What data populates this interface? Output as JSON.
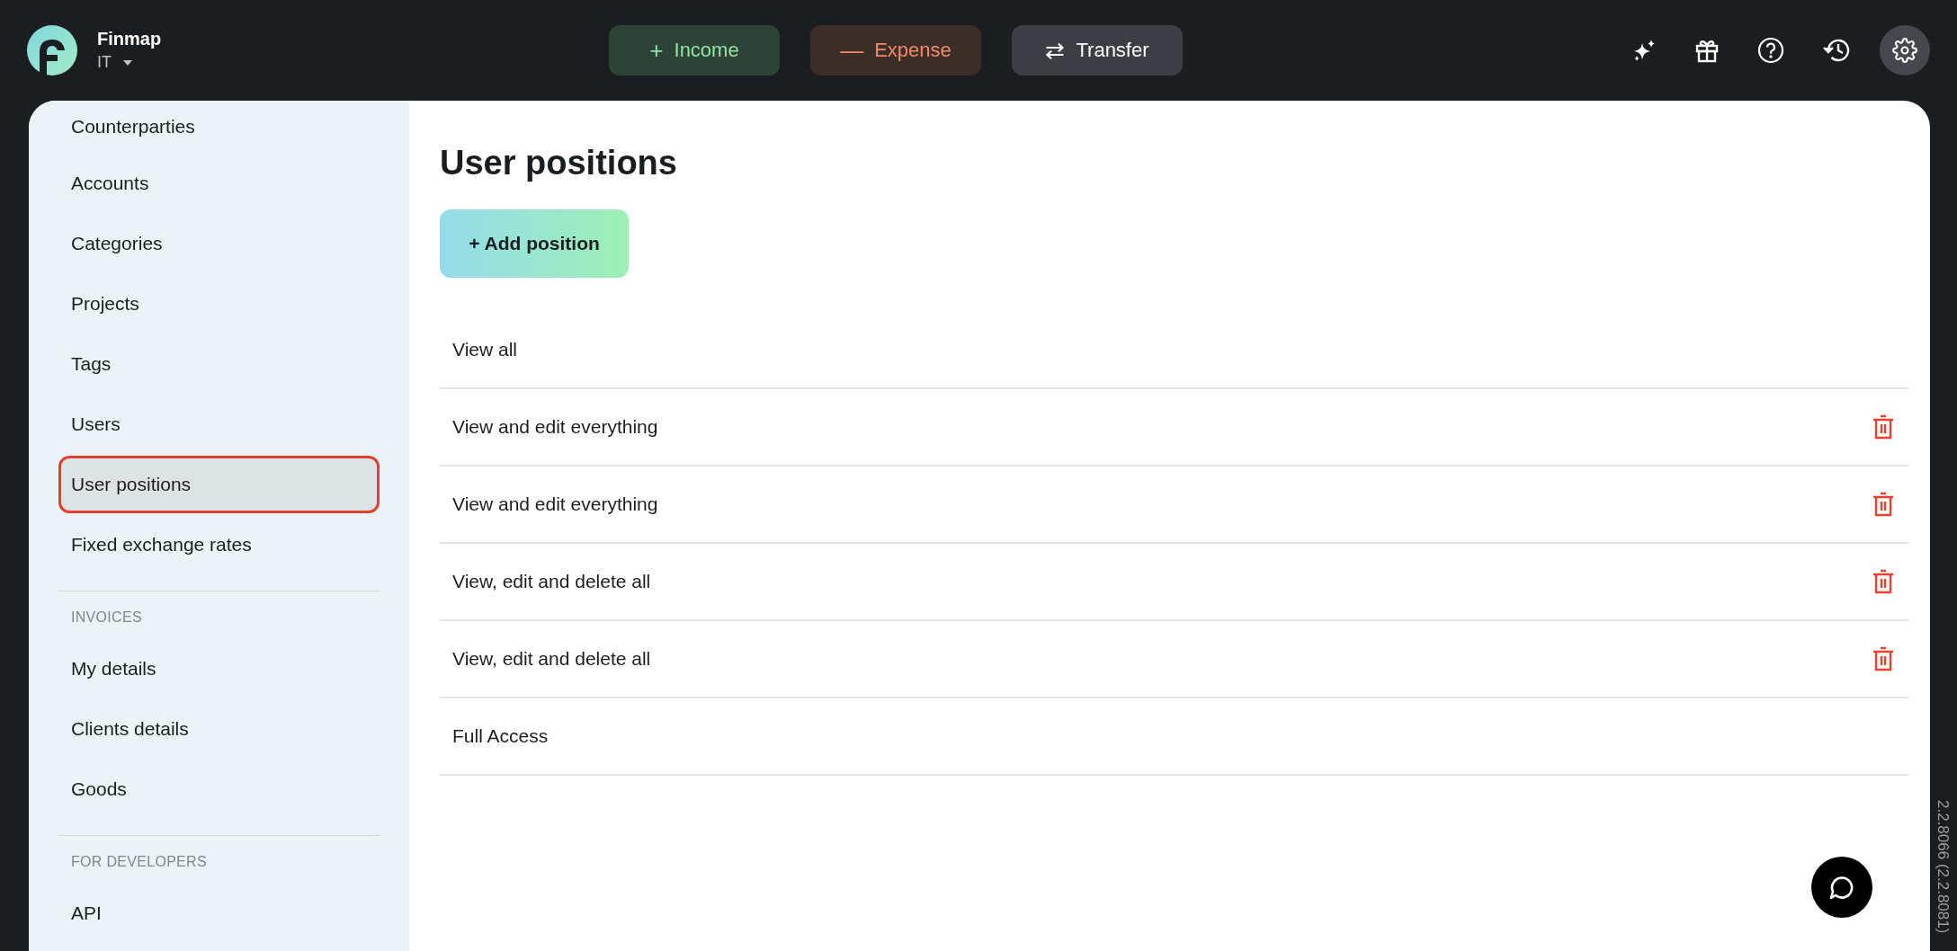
{
  "brand": {
    "name": "Finmap",
    "company": "IT"
  },
  "actions": [
    {
      "kind": "income",
      "label": "Income",
      "icon": "+"
    },
    {
      "kind": "expense",
      "label": "Expense",
      "icon": "—"
    },
    {
      "kind": "transfer",
      "label": "Transfer",
      "icon": "⇄"
    }
  ],
  "sidebar": {
    "groups": [
      {
        "items": [
          {
            "label": "Counterparties",
            "selected": false
          },
          {
            "label": "Accounts",
            "selected": false
          },
          {
            "label": "Categories",
            "selected": false
          },
          {
            "label": "Projects",
            "selected": false
          },
          {
            "label": "Tags",
            "selected": false
          },
          {
            "label": "Users",
            "selected": false
          },
          {
            "label": "User positions",
            "selected": true
          },
          {
            "label": "Fixed exchange rates",
            "selected": false
          }
        ]
      },
      {
        "heading": "INVOICES",
        "items": [
          {
            "label": "My details",
            "selected": false
          },
          {
            "label": "Clients details",
            "selected": false
          },
          {
            "label": "Goods",
            "selected": false
          }
        ]
      },
      {
        "heading": "FOR DEVELOPERS",
        "items": [
          {
            "label": "API",
            "selected": false
          }
        ]
      }
    ]
  },
  "page": {
    "title": "User positions",
    "add_button": "+ Add position",
    "positions": [
      {
        "name": "View all",
        "deletable": false
      },
      {
        "name": "View and edit everything",
        "deletable": true
      },
      {
        "name": "View and edit everything",
        "deletable": true
      },
      {
        "name": "View, edit and delete all",
        "deletable": true
      },
      {
        "name": "View, edit and delete all",
        "deletable": true
      },
      {
        "name": "Full Access",
        "deletable": false
      }
    ]
  },
  "version": "2.2.8066 (2.2.8081)"
}
